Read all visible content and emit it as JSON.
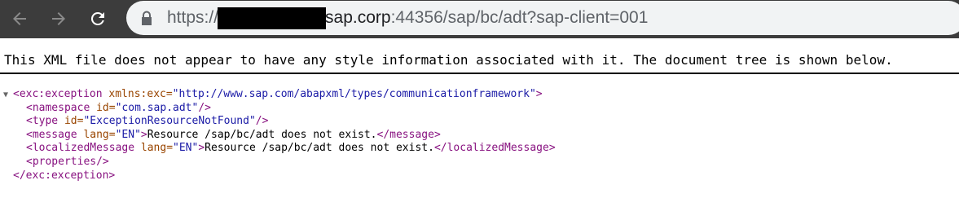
{
  "browser": {
    "url_scheme_prefix": "https://",
    "url_host_suffix": "sap.corp",
    "url_rest": ":44356/sap/bc/adt?sap-client=001",
    "back_icon": "arrow-left-icon",
    "forward_icon": "arrow-right-icon",
    "reload_icon": "reload-icon",
    "lock_icon": "lock-icon",
    "toolbar_color": "#3c3c3c",
    "omnibox_color": "#f1f3f4"
  },
  "viewer": {
    "info_message": "This XML file does not appear to have any style information associated with it. The document tree is shown below."
  },
  "xml": {
    "toggle": "▼",
    "root": {
      "open_tag": "<exc:exception",
      "attr_name": " xmlns:exc=",
      "attr_value": "\"http://www.sap.com/abapxml/types/communicationframework\"",
      "open_tag_end": ">",
      "close_tag": "</exc:exception>"
    },
    "namespace": {
      "open": "<namespace",
      "attr_name": " id=",
      "attr_value": "\"com.sap.adt\"",
      "end": "/>"
    },
    "type": {
      "open": "<type",
      "attr_name": " id=",
      "attr_value": "\"ExceptionResourceNotFound\"",
      "end": "/>"
    },
    "message": {
      "open": "<message",
      "attr_name": " lang=",
      "attr_value": "\"EN\"",
      "open_end": ">",
      "text": "Resource /sap/bc/adt does not exist.",
      "close": "</message>"
    },
    "localized_message": {
      "open": "<localizedMessage",
      "attr_name": " lang=",
      "attr_value": "\"EN\"",
      "open_end": ">",
      "text": "Resource /sap/bc/adt does not exist.",
      "close": "</localizedMessage>"
    },
    "properties": {
      "tag": "<properties/>"
    }
  }
}
